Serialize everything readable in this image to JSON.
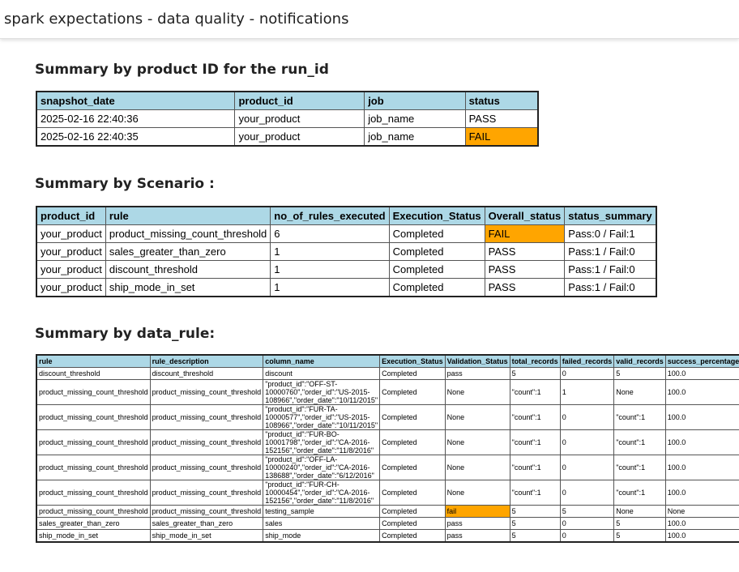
{
  "header": {
    "title": "spark expectations - data quality - notifications"
  },
  "colors": {
    "header_bg": "#add8e6",
    "fail_highlight": "#ffa500"
  },
  "section1": {
    "title": "Summary by product ID for the run_id",
    "columns": [
      "snapshot_date",
      "product_id",
      "job",
      "status"
    ],
    "rows": [
      [
        "2025-02-16 22:40:36",
        "your_product",
        "job_name",
        "PASS"
      ],
      [
        "2025-02-16 22:40:35",
        "your_product",
        "job_name",
        "FAIL"
      ]
    ]
  },
  "section2": {
    "title": "Summary by Scenario :",
    "columns": [
      "product_id",
      "rule",
      "no_of_rules_executed",
      "Execution_Status",
      "Overall_status",
      "status_summary"
    ],
    "rows": [
      [
        "your_product",
        "product_missing_count_threshold",
        "6",
        "Completed",
        "FAIL",
        "Pass:0 / Fail:1"
      ],
      [
        "your_product",
        "sales_greater_than_zero",
        "1",
        "Completed",
        "PASS",
        "Pass:1 / Fail:0"
      ],
      [
        "your_product",
        "discount_threshold",
        "1",
        "Completed",
        "PASS",
        "Pass:1 / Fail:0"
      ],
      [
        "your_product",
        "ship_mode_in_set",
        "1",
        "Completed",
        "PASS",
        "Pass:1 / Fail:0"
      ]
    ]
  },
  "section3": {
    "title": "Summary by data_rule:",
    "columns": [
      "rule",
      "rule_description",
      "column_name",
      "Execution_Status",
      "Validation_Status",
      "total_records",
      "failed_records",
      "valid_records",
      "success_percentage"
    ],
    "rows": [
      [
        "discount_threshold",
        "discount_threshold",
        "discount",
        "Completed",
        "pass",
        "5",
        "0",
        "5",
        "100.0"
      ],
      [
        "product_missing_count_threshold",
        "product_missing_count_threshold",
        "\"product_id\":\"OFF-ST-10000760\",\"order_id\":\"US-2015-108966\",\"order_date\":\"10/11/2015\"",
        "Completed",
        "None",
        "\"count\":1",
        "1",
        "None",
        "100.0"
      ],
      [
        "product_missing_count_threshold",
        "product_missing_count_threshold",
        "\"product_id\":\"FUR-TA-10000577\",\"order_id\":\"US-2015-108966\",\"order_date\":\"10/11/2015\"",
        "Completed",
        "None",
        "\"count\":1",
        "0",
        "\"count\":1",
        "100.0"
      ],
      [
        "product_missing_count_threshold",
        "product_missing_count_threshold",
        "\"product_id\":\"FUR-BO-10001798\",\"order_id\":\"CA-2016-152156\",\"order_date\":\"11/8/2016\"",
        "Completed",
        "None",
        "\"count\":1",
        "0",
        "\"count\":1",
        "100.0"
      ],
      [
        "product_missing_count_threshold",
        "product_missing_count_threshold",
        "\"product_id\":\"OFF-LA-10000240\",\"order_id\":\"CA-2016-138688\",\"order_date\":\"6/12/2016\"",
        "Completed",
        "None",
        "\"count\":1",
        "0",
        "\"count\":1",
        "100.0"
      ],
      [
        "product_missing_count_threshold",
        "product_missing_count_threshold",
        "\"product_id\":\"FUR-CH-10000454\",\"order_id\":\"CA-2016-152156\",\"order_date\":\"11/8/2016\"",
        "Completed",
        "None",
        "\"count\":1",
        "0",
        "\"count\":1",
        "100.0"
      ],
      [
        "product_missing_count_threshold",
        "product_missing_count_threshold",
        "testing_sample",
        "Completed",
        "fail",
        "5",
        "5",
        "None",
        "None"
      ],
      [
        "sales_greater_than_zero",
        "sales_greater_than_zero",
        "sales",
        "Completed",
        "pass",
        "5",
        "0",
        "5",
        "100.0"
      ],
      [
        "ship_mode_in_set",
        "ship_mode_in_set",
        "ship_mode",
        "Completed",
        "pass",
        "5",
        "0",
        "5",
        "100.0"
      ]
    ]
  }
}
